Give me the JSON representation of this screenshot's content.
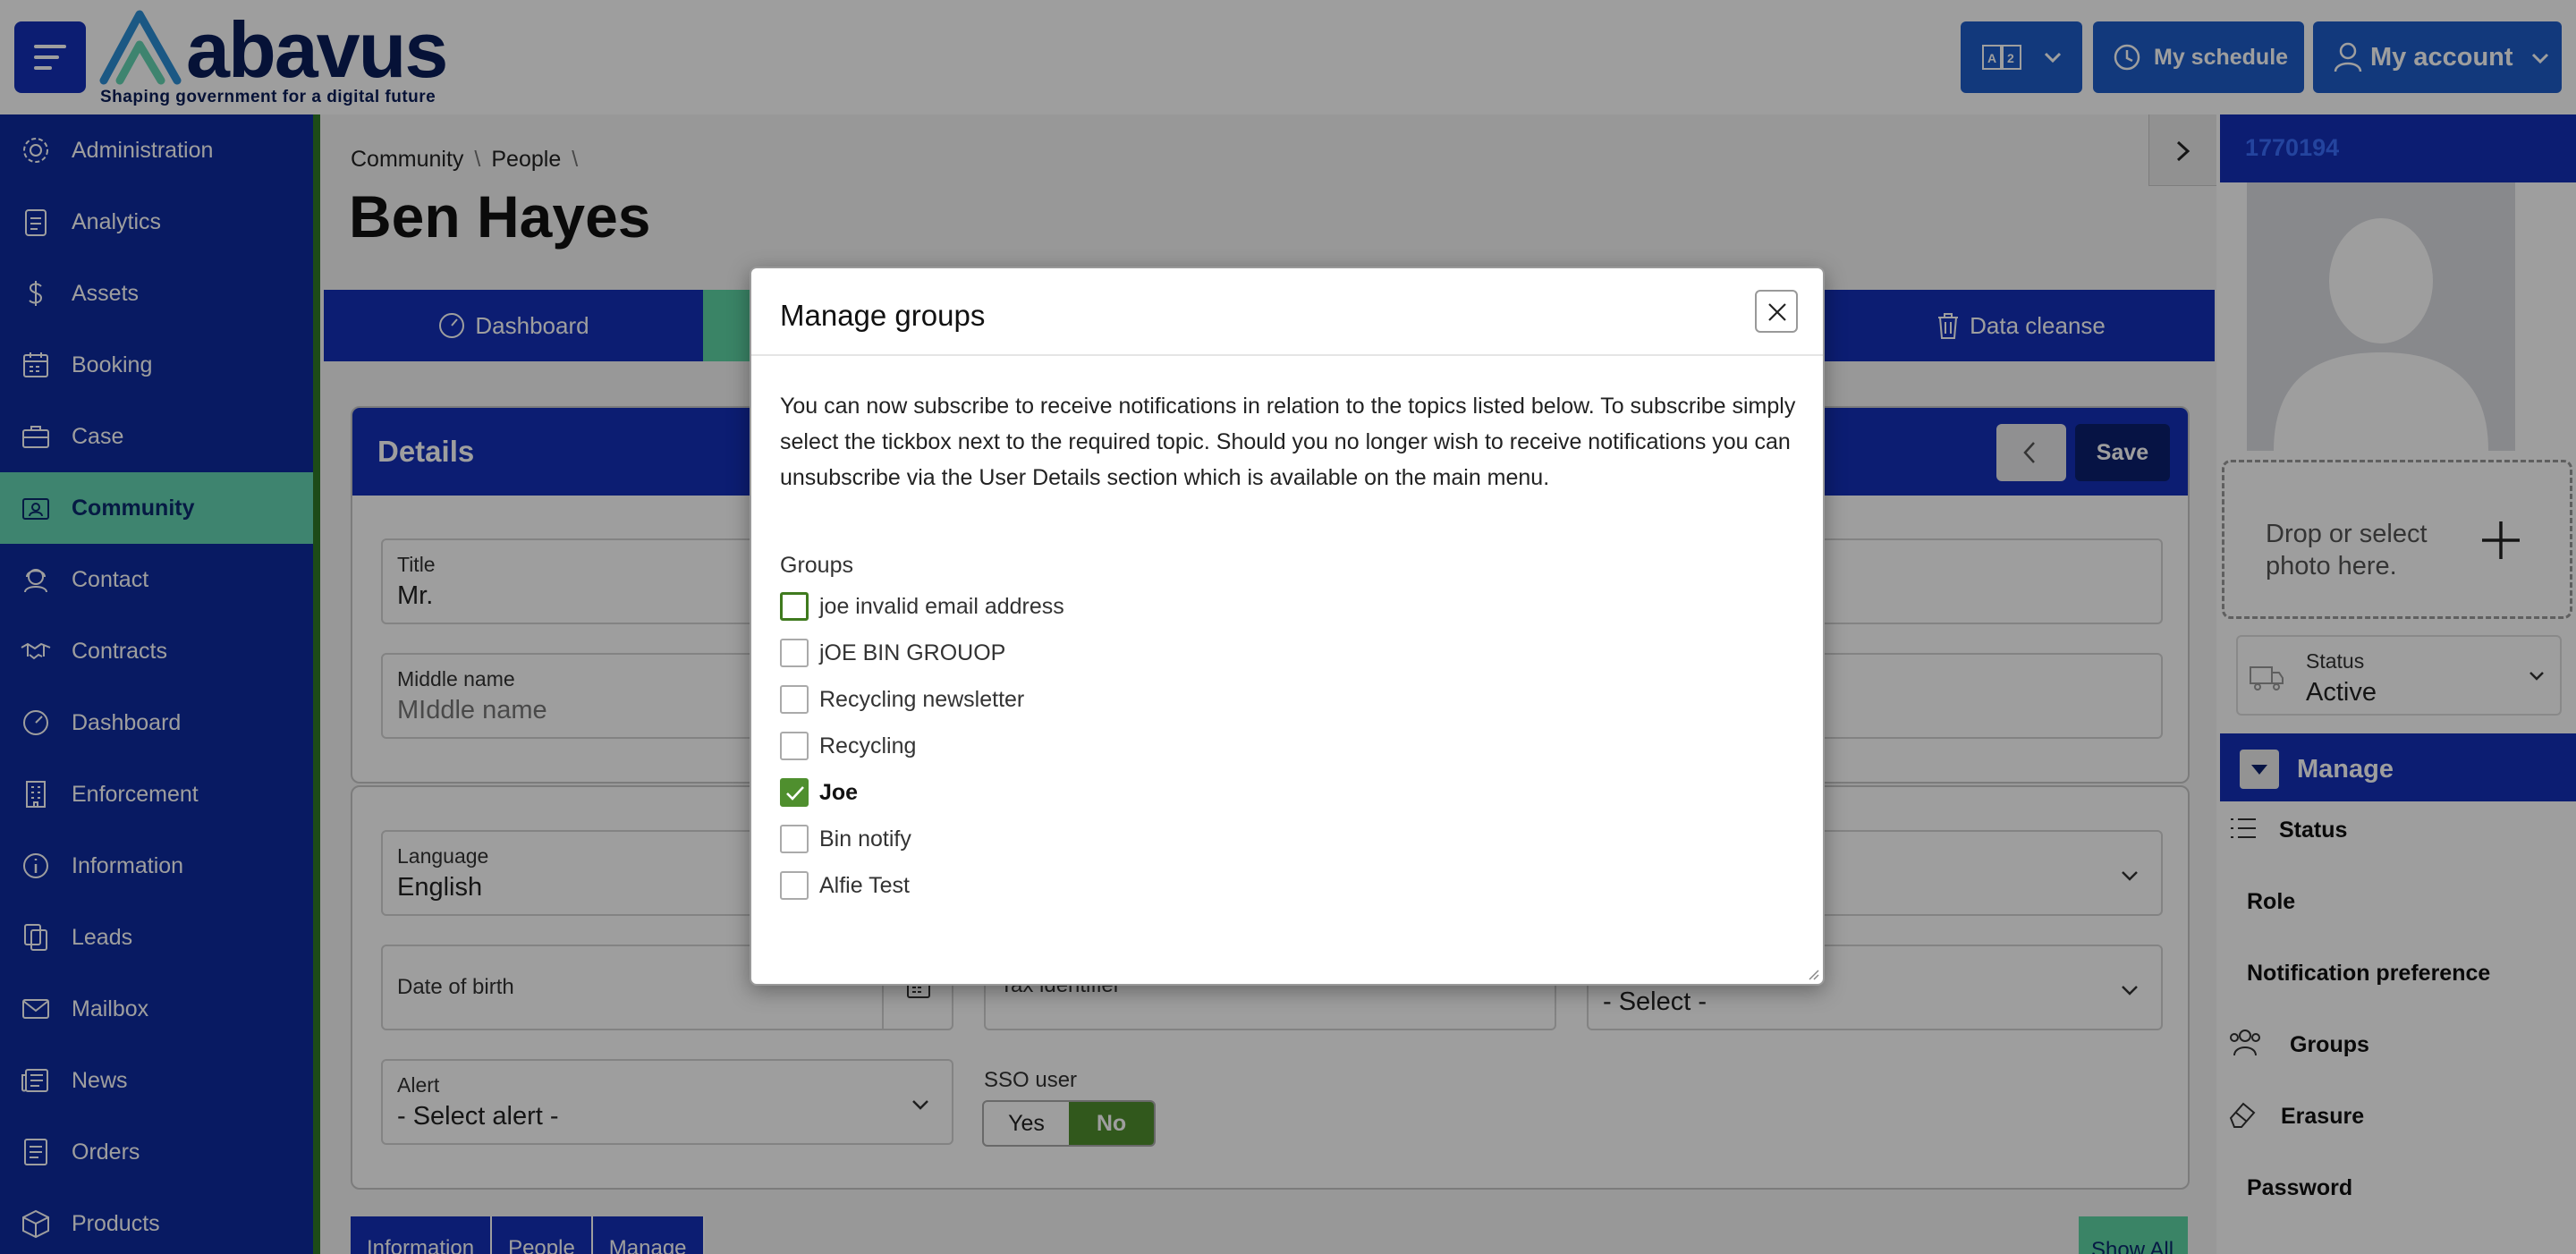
{
  "brand": {
    "name": "abavus",
    "tagline": "Shaping government for a digital future",
    "primary_color": "#1430b8",
    "accent_color": "#65d6b3"
  },
  "header": {
    "schedule_label": "My schedule",
    "account_label": "My account"
  },
  "sidebar": {
    "items": [
      {
        "label": "Administration",
        "icon": "gear-icon"
      },
      {
        "label": "Analytics",
        "icon": "clipboard-icon"
      },
      {
        "label": "Assets",
        "icon": "dollar-icon"
      },
      {
        "label": "Booking",
        "icon": "calendar-icon"
      },
      {
        "label": "Case",
        "icon": "briefcase-icon"
      },
      {
        "label": "Community",
        "icon": "id-card-icon",
        "active": true
      },
      {
        "label": "Contact",
        "icon": "headset-icon"
      },
      {
        "label": "Contracts",
        "icon": "handshake-icon"
      },
      {
        "label": "Dashboard",
        "icon": "gauge-icon"
      },
      {
        "label": "Enforcement",
        "icon": "building-icon"
      },
      {
        "label": "Information",
        "icon": "info-icon"
      },
      {
        "label": "Leads",
        "icon": "copy-icon"
      },
      {
        "label": "Mailbox",
        "icon": "envelope-icon"
      },
      {
        "label": "News",
        "icon": "newspaper-icon"
      },
      {
        "label": "Orders",
        "icon": "list-icon"
      },
      {
        "label": "Products",
        "icon": "box-icon"
      }
    ]
  },
  "breadcrumb": [
    "Community",
    "People"
  ],
  "page_title": "Ben Hayes",
  "tabs": {
    "dashboard": "Dashboard",
    "data_cleanse": "Data cleanse"
  },
  "details": {
    "title": "Details",
    "save_label": "Save",
    "fields": {
      "title_label": "Title",
      "title_value": "Mr.",
      "middle_name_label": "Middle name",
      "middle_name_placeholder": "MIddle name",
      "language_label": "Language",
      "language_value": "English",
      "dob_label": "Date of birth",
      "tax_label": "Tax identifier",
      "select_placeholder": "- Select -",
      "alert_label": "Alert",
      "alert_value": "- Select alert -",
      "sso_label": "SSO user",
      "sso_yes": "Yes",
      "sso_no": "No",
      "sso_value": "No"
    }
  },
  "bottom_tabs": [
    "Information",
    "People",
    "Manage"
  ],
  "show_all_label": "Show All",
  "right_panel": {
    "record_id": "1770194",
    "drop_text": "Drop or select photo here.",
    "status_label": "Status",
    "status_value": "Active",
    "manage_label": "Manage",
    "manage_items": [
      {
        "label": "Status",
        "icon": "list-icon"
      },
      {
        "label": "Role",
        "icon": ""
      },
      {
        "label": "Notification preference",
        "icon": ""
      },
      {
        "label": "Groups",
        "icon": "users-icon"
      },
      {
        "label": "Erasure",
        "icon": "eraser-icon"
      },
      {
        "label": "Password",
        "icon": ""
      }
    ]
  },
  "modal": {
    "title": "Manage groups",
    "body": "You can now subscribe to receive notifications in relation to the topics listed below. To subscribe simply select the tickbox next to the required topic. Should you no longer wish to receive notifications you can unsubscribe via the User Details section which is available on the main menu.",
    "groups_label": "Groups",
    "groups": [
      {
        "label": "joe invalid email address",
        "checked": false,
        "focused": true
      },
      {
        "label": "jOE BIN GROUOP",
        "checked": false
      },
      {
        "label": "Recycling newsletter",
        "checked": false
      },
      {
        "label": "Recycling",
        "checked": false
      },
      {
        "label": "Joe",
        "checked": true
      },
      {
        "label": "Bin notify",
        "checked": false
      },
      {
        "label": "Alfie Test",
        "checked": false
      }
    ]
  }
}
